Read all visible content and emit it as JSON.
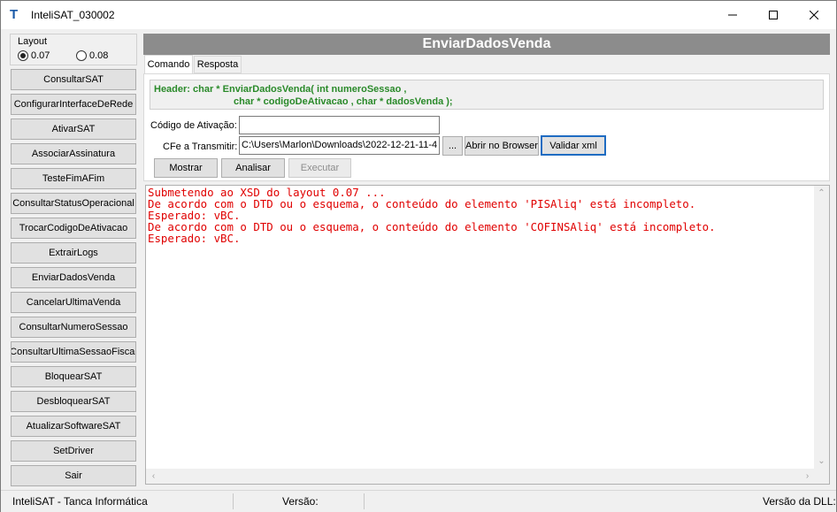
{
  "window": {
    "title": "InteliSAT_030002",
    "icon": "intelisat-logo-icon"
  },
  "layout": {
    "label": "Layout",
    "options": [
      {
        "label": "0.07",
        "selected": true
      },
      {
        "label": "0.08",
        "selected": false
      }
    ]
  },
  "sidebar": {
    "buttons": [
      "ConsultarSAT",
      "ConfigurarInterfaceDeRede",
      "AtivarSAT",
      "AssociarAssinatura",
      "TesteFimAFim",
      "ConsultarStatusOperacional",
      "TrocarCodigoDeAtivacao",
      "ExtrairLogs",
      "EnviarDadosVenda",
      "CancelarUltimaVenda",
      "ConsultarNumeroSessao",
      "ConsultarUltimaSessaoFiscal",
      "BloquearSAT",
      "DesbloquearSAT",
      "AtualizarSoftwareSAT",
      "SetDriver",
      "Sair"
    ]
  },
  "main": {
    "title": "EnviarDadosVenda",
    "tabs": [
      {
        "label": "Comando",
        "active": true
      },
      {
        "label": "Resposta",
        "active": false
      }
    ],
    "header_line1": "Header: char * EnviarDadosVenda( int numeroSessao ,",
    "header_line2": "char * codigoDeAtivacao , char * dadosVenda );",
    "codigo_label": "Código de Ativação:",
    "codigo_value": "",
    "cfe_label": "CFe a Transmitir:",
    "cfe_value": "C:\\Users\\Marlon\\Downloads\\2022-12-21-11-4",
    "browse_label": "...",
    "abrir_label": "Abrir no Browser",
    "validar_label": "Validar xml",
    "mostrar_label": "Mostrar",
    "analisar_label": "Analisar",
    "executar_label": "Executar"
  },
  "output": {
    "lines": [
      "Submetendo ao XSD do layout 0.07 ...",
      "De acordo com o DTD ou o esquema, o conteúdo do elemento 'PISAliq' está incompleto.",
      "Esperado: vBC.",
      "De acordo com o DTD ou o esquema, o conteúdo do elemento 'COFINSAliq' está incompleto.",
      "Esperado: vBC."
    ],
    "color": "#e00000"
  },
  "status": {
    "company": "InteliSAT - Tanca Informática",
    "versao": "Versão:",
    "versao_dll": "Versão da DLL:"
  }
}
